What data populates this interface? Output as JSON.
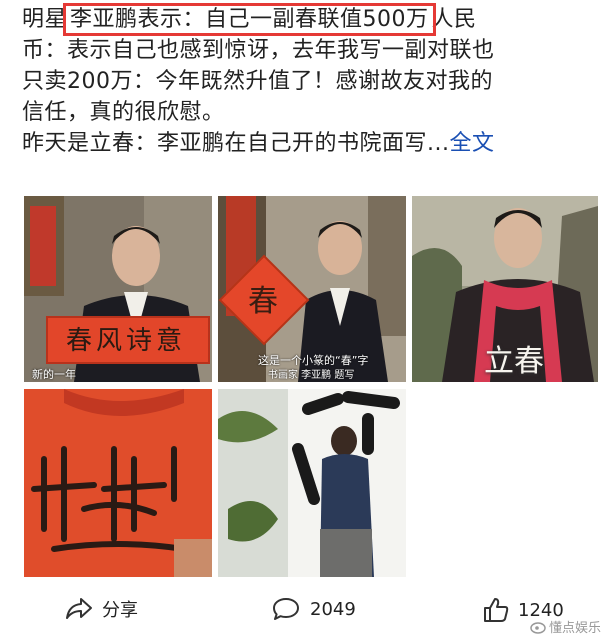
{
  "post": {
    "line1_prefix": "明星",
    "line1_highlight": "李亚鹏表示：自己一副春联值500万",
    "line1_suffix": "人民",
    "line2": "币：表示自己也感到惊讶，去年我写一副对联也",
    "line3": "只卖200万：今年既然升值了！感谢故友对我的",
    "line4": "信任，真的很欣慰。",
    "line5": "昨天是立春：李亚鹏在自己开的书院面写...",
    "more_link": "全文"
  },
  "photos": {
    "p1_banner": "春风诗意",
    "p1_caption": "新的一年",
    "p2_diamond": "春",
    "p2_caption1": "这是一个小篆的“春”字",
    "p2_caption2": "书画家 李亚鹏 题写",
    "p3_overlay": "立春"
  },
  "actions": {
    "share_label": "分享",
    "share_icon": "share-icon",
    "comment_count": "2049",
    "comment_icon": "comment-icon",
    "like_count": "1240",
    "like_icon": "thumbs-up-icon"
  },
  "watermark": "懂点娱乐",
  "colors": {
    "highlight_box": "#e53935",
    "link": "#1a4fb3",
    "text": "#222222"
  }
}
